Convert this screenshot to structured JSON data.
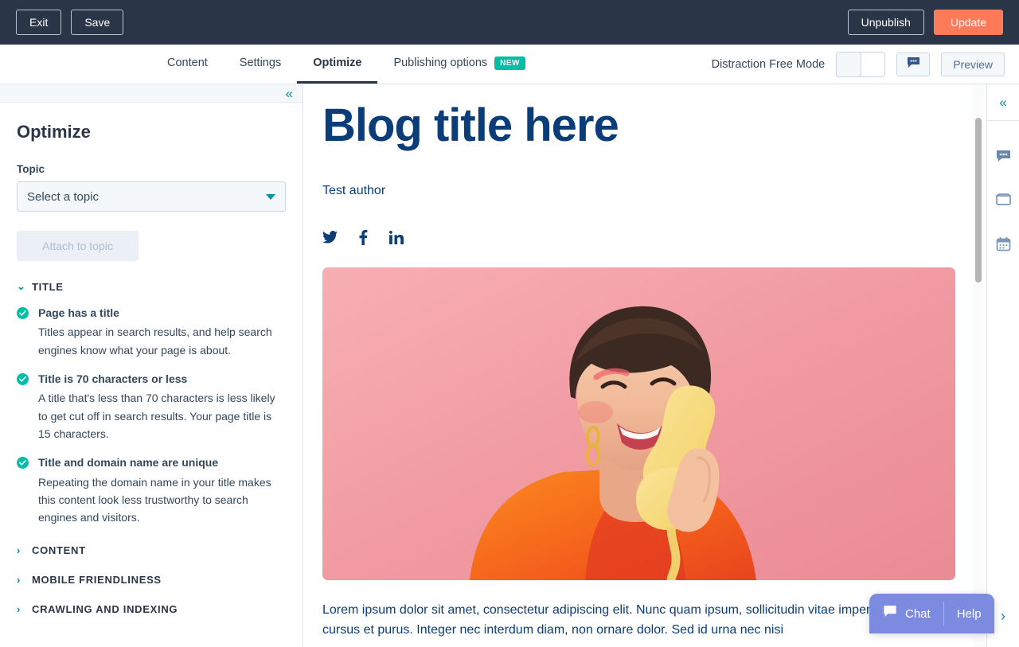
{
  "topbar": {
    "exit_label": "Exit",
    "save_label": "Save",
    "unpublish_label": "Unpublish",
    "update_label": "Update",
    "background_color": "#2a3647",
    "primary_color": "#ff7a59"
  },
  "nav": {
    "tabs": [
      {
        "label": "Content",
        "active": false
      },
      {
        "label": "Settings",
        "active": false
      },
      {
        "label": "Optimize",
        "active": true
      },
      {
        "label": "Publishing options",
        "active": false,
        "badge": "NEW"
      }
    ],
    "distraction_free_label": "Distraction Free Mode",
    "toggle_state": "off",
    "comment_icon": "comment-icon",
    "preview_label": "Preview",
    "badge_color": "#00bda5"
  },
  "sidebar": {
    "collapse_icon": "double-chevron-left-icon",
    "title": "Optimize",
    "topic_label": "Topic",
    "topic_value": "Select a topic",
    "topic_caret": "caret-down-icon",
    "attach_label": "Attach to topic",
    "sections": [
      {
        "name": "TITLE",
        "expanded": true,
        "chevron": "chevron-down-icon",
        "items": [
          {
            "status": "pass",
            "title": "Page has a title",
            "description": "Titles appear in search results, and help search engines know what your page is about."
          },
          {
            "status": "pass",
            "title": "Title is 70 characters or less",
            "description": "A title that's less than 70 characters is less likely to get cut off in search results. Your page title is 15 characters."
          },
          {
            "status": "pass",
            "title": "Title and domain name are unique",
            "description": "Repeating the domain name in your title makes this content look less trustworthy to search engines and visitors."
          }
        ]
      },
      {
        "name": "CONTENT",
        "expanded": false,
        "chevron": "chevron-right-icon",
        "items": []
      },
      {
        "name": "MOBILE FRIENDLINESS",
        "expanded": false,
        "chevron": "chevron-right-icon",
        "items": []
      },
      {
        "name": "CRAWLING AND INDEXING",
        "expanded": false,
        "chevron": "chevron-right-icon",
        "items": []
      }
    ],
    "pass_color": "#00bda5"
  },
  "editor": {
    "blog_title": "Blog title here",
    "author": "Test author",
    "title_color": "#0b3d78",
    "social": [
      {
        "name": "twitter-icon"
      },
      {
        "name": "facebook-icon"
      },
      {
        "name": "linkedin-icon"
      }
    ],
    "hero_image_alt": "Woman smiling while holding a yellow retro telephone against a pink background",
    "paragraph": "Lorem ipsum dolor sit amet, consectetur adipiscing elit. Nunc quam ipsum, sollicitudin vitae imperdiet vitae, cursus et purus. Integer nec interdum diam, non ornare dolor. Sed id urna nec nisi"
  },
  "right_rail": {
    "collapse_icon": "double-chevron-left-icon",
    "icons": [
      "comment-icon",
      "card-icon",
      "calendar-icon"
    ],
    "expand_icon": "chevron-right-icon"
  },
  "chat_widget": {
    "chat_label": "Chat",
    "help_label": "Help",
    "chat_icon": "chat-bubble-icon",
    "color": "#7c8ae0"
  }
}
